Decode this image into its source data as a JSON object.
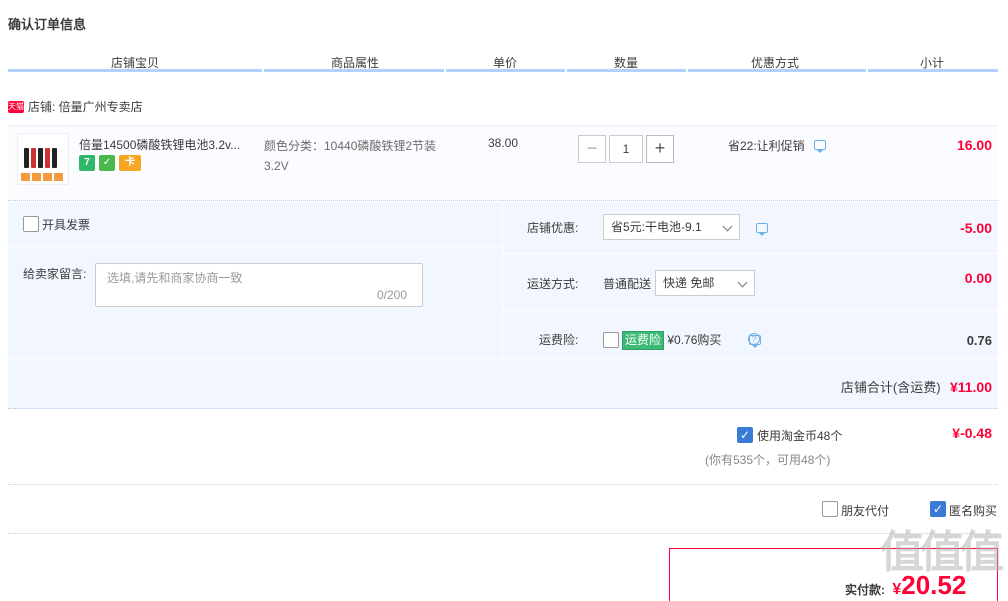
{
  "page_title": "确认订单信息",
  "table_headers": [
    "店铺宝贝",
    "商品属性",
    "单价",
    "数量",
    "优惠方式",
    "小计"
  ],
  "shop": {
    "badge": "天猫",
    "label": "店铺: 倍量广州专卖店"
  },
  "item": {
    "title": "倍量14500磷酸铁锂电池3.2v...",
    "attr_line1": "颜色分类：10440磷酸铁锂2节装",
    "attr_line2": "3.2V",
    "price": "38.00",
    "quantity": "1",
    "minus_label": "−",
    "plus_label": "+",
    "promo": "省22:让利促销",
    "subtotal": "16.00",
    "badges": [
      "7",
      "✓",
      "卡"
    ]
  },
  "invoice": {
    "label": "开具发票"
  },
  "message": {
    "label": "给卖家留言:",
    "placeholder": "选填,请先和商家协商一致",
    "counter": "0/200"
  },
  "shop_discount": {
    "label": "店铺优惠:",
    "selected": "省5元:干电池-9.1",
    "value": "-5.00"
  },
  "shipping": {
    "label": "运送方式:",
    "method": "普通配送",
    "selected": "快递 免邮",
    "value": "0.00"
  },
  "insurance": {
    "label": "运费险:",
    "tag": "运费险",
    "price_text": "¥0.76购买",
    "value": "0.76"
  },
  "shop_total": {
    "label": "店铺合计(含运费)",
    "value": "¥11.00"
  },
  "coins": {
    "label": "使用淘金币48个",
    "sub": "(你有535个，可用48个)",
    "value": "¥-0.48"
  },
  "friend_pay": {
    "label": "朋友代付"
  },
  "anonymous": {
    "label": "匿名购买"
  },
  "payment": {
    "label": "实付款:",
    "currency": "¥",
    "amount": "20.52"
  },
  "watermark": "值值值",
  "colors": {
    "accent_red": "#ff0036",
    "header_line": "#b2d1ff",
    "panel_bg": "#f2f7ff",
    "checkbox_blue": "#3a7bd5",
    "insurance_green": "#3dba74"
  }
}
